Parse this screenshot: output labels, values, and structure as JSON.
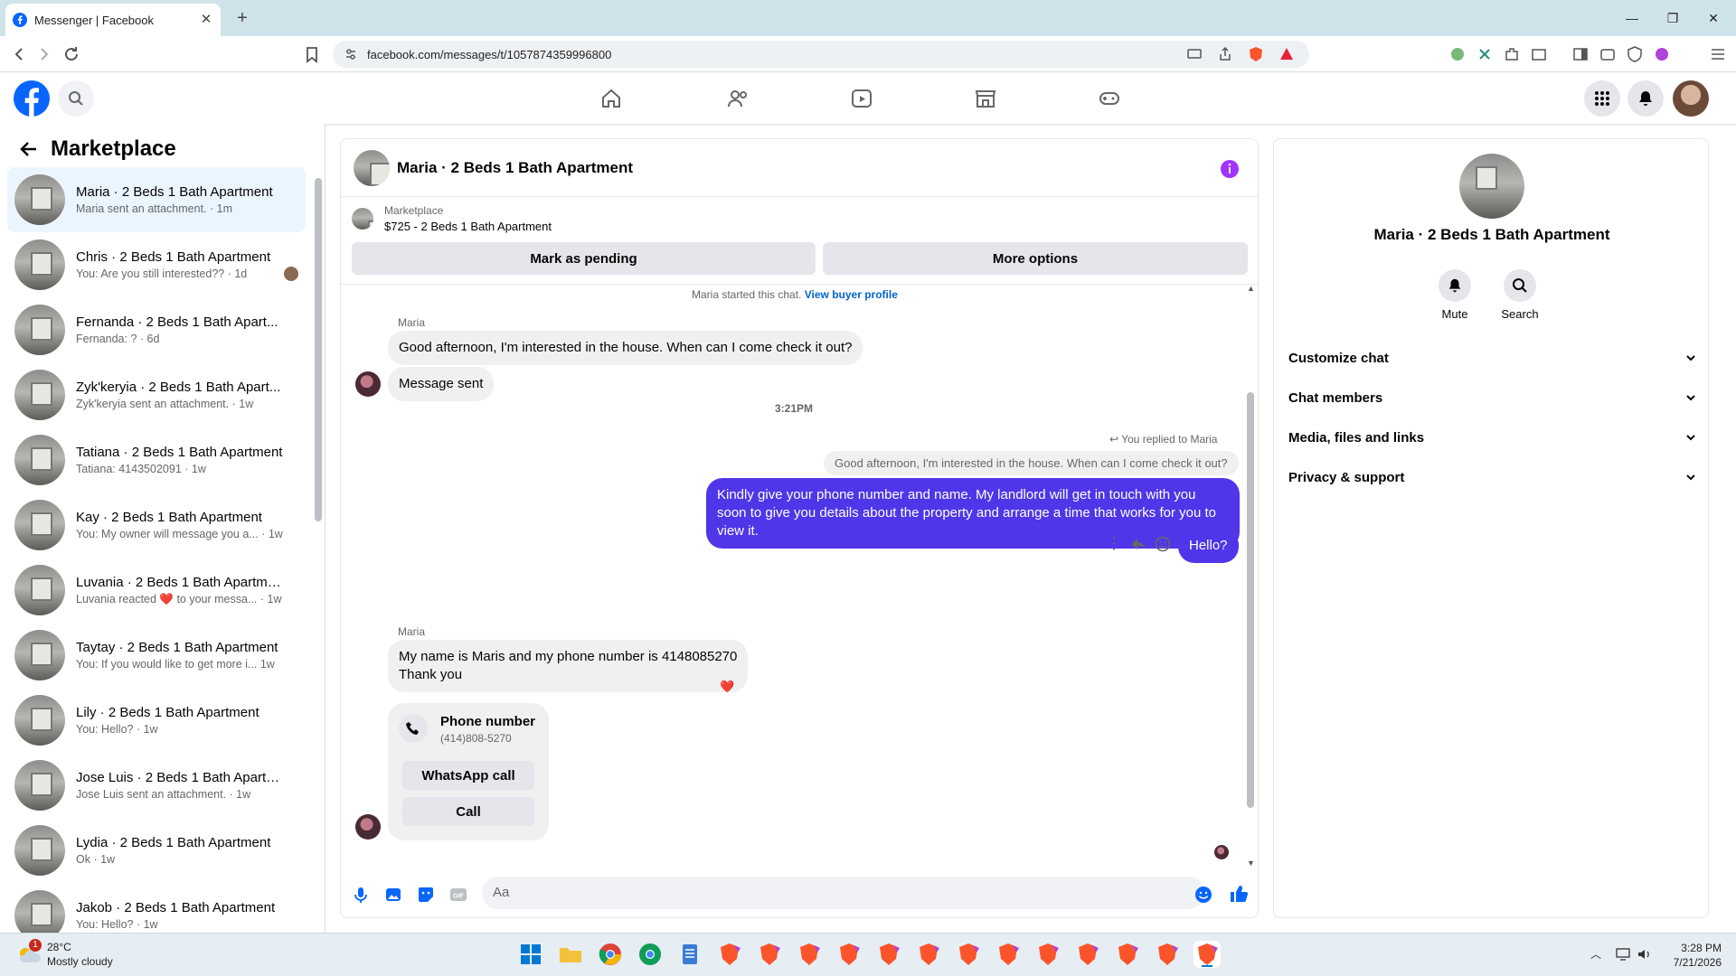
{
  "browser": {
    "tab_title": "Messenger | Facebook",
    "url": "facebook.com/messages/t/1057874359996800"
  },
  "left": {
    "title": "Marketplace",
    "conversations": [
      {
        "name": "Maria · 2 Beds 1 Bath Apartment",
        "snippet": "Maria sent an attachment. · 1m",
        "active": true
      },
      {
        "name": "Chris · 2 Beds 1 Bath Apartment",
        "snippet": "You: Are you still interested?? · 1d"
      },
      {
        "name": "Fernanda · 2 Beds 1 Bath Apart...",
        "snippet": "Fernanda: ? · 6d"
      },
      {
        "name": "Zyk'keryia · 2 Beds 1 Bath Apart...",
        "snippet": "Zyk'keryia sent an attachment. · 1w"
      },
      {
        "name": "Tatiana · 2 Beds 1 Bath Apartment",
        "snippet": "Tatiana: 4143502091 · 1w"
      },
      {
        "name": "Kay · 2 Beds 1 Bath Apartment",
        "snippet": "You: My owner will message you a... · 1w"
      },
      {
        "name": "Luvania · 2 Beds 1 Bath Apartment",
        "snippet": "Luvania reacted ❤️ to your messa... · 1w"
      },
      {
        "name": "Taytay · 2 Beds 1 Bath Apartment",
        "snippet": "You: If you would like to get more i... 1w"
      },
      {
        "name": "Lily · 2 Beds 1 Bath Apartment",
        "snippet": "You: Hello? · 1w"
      },
      {
        "name": "Jose Luis · 2 Beds 1 Bath Apartm...",
        "snippet": "Jose Luis sent an attachment. · 1w"
      },
      {
        "name": "Lydia · 2 Beds 1 Bath Apartment",
        "snippet": "Ok · 1w"
      },
      {
        "name": "Jakob · 2 Beds 1 Bath Apartment",
        "snippet": "You: Hello? · 1w"
      }
    ]
  },
  "chat": {
    "title": "Maria · 2 Beds 1 Bath Apartment",
    "listing_label": "Marketplace",
    "listing_title": "$725 - 2 Beds 1 Bath Apartment",
    "btn_pending": "Mark as pending",
    "btn_more": "More options",
    "started_note": "Maria started this chat.",
    "view_profile": "View buyer profile",
    "sender1": "Maria",
    "msg1": "Good afternoon, I'm interested in the house. When can I come check it out?",
    "msg2": "Message sent",
    "timestamp": "3:21PM",
    "replied_note": "You replied to Maria",
    "quoted": "Good afternoon, I'm interested in the house. When can I come check it out?",
    "msg_out1": "Kindly give your phone number and name. My landlord will get in touch with you soon to give you details about the property and arrange a time that works for you to view it.",
    "msg_out2": "Hello?",
    "sender2": "Maria",
    "msg3_line1": "My name is Maris and my phone number is 4148085270",
    "msg3_line2": "Thank you",
    "reaction": "❤️",
    "card_title": "Phone number",
    "card_number": "(414)808-5270",
    "card_btn1": "WhatsApp call",
    "card_btn2": "Call",
    "input_placeholder": "Aa"
  },
  "right": {
    "name": "Maria · 2 Beds 1 Bath Apartment",
    "mute": "Mute",
    "search": "Search",
    "items": [
      "Customize chat",
      "Chat members",
      "Media, files and links",
      "Privacy & support"
    ]
  },
  "taskbar": {
    "badge": "1",
    "temp": "28°C",
    "weather": "Mostly cloudy",
    "time": "3:28 PM",
    "date": "7/21/2026"
  },
  "colors": {
    "brand": "#0866ff",
    "outgoing_bubble": "#4f36e8",
    "info_icon": "#a033ff"
  }
}
